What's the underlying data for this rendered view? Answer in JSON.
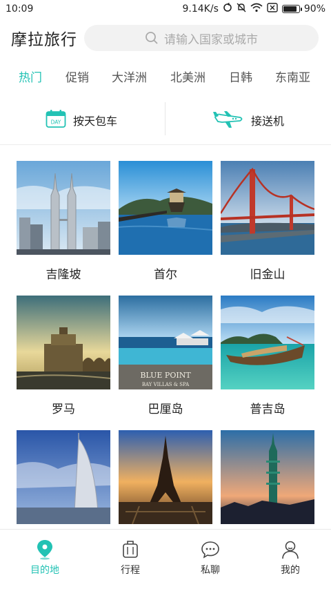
{
  "status_bar": {
    "time": "10:09",
    "speed": "9.14K/s",
    "battery": "90%",
    "battery_level": 0.9
  },
  "header": {
    "title": "摩拉旅行",
    "search_placeholder": "请输入国家或城市"
  },
  "tabs": [
    {
      "label": "热门",
      "active": true
    },
    {
      "label": "促销"
    },
    {
      "label": "大洋洲"
    },
    {
      "label": "北美洲"
    },
    {
      "label": "日韩"
    },
    {
      "label": "东南亚"
    }
  ],
  "services": {
    "charter": {
      "label": "按天包车",
      "icon": "calendar-day-icon",
      "icon_text": "DAY"
    },
    "airport": {
      "label": "接送机",
      "icon": "airplane-icon"
    }
  },
  "destinations": [
    {
      "name": "吉隆坡"
    },
    {
      "name": "首尔"
    },
    {
      "name": "旧金山"
    },
    {
      "name": "罗马"
    },
    {
      "name": "巴厘岛",
      "image_text": [
        "BLUE POINT",
        "BAY VILLAS & SPA"
      ]
    },
    {
      "name": "普吉岛"
    },
    {
      "name": ""
    },
    {
      "name": ""
    },
    {
      "name": ""
    }
  ],
  "bottom_nav": [
    {
      "label": "目的地",
      "icon": "location-pin-icon",
      "active": true
    },
    {
      "label": "行程",
      "icon": "luggage-icon"
    },
    {
      "label": "私聊",
      "icon": "chat-bubble-icon"
    },
    {
      "label": "我的",
      "icon": "user-icon"
    }
  ],
  "colors": {
    "accent": "#22c2b4",
    "text": "#222222",
    "search_bg": "#f2f2f2"
  }
}
